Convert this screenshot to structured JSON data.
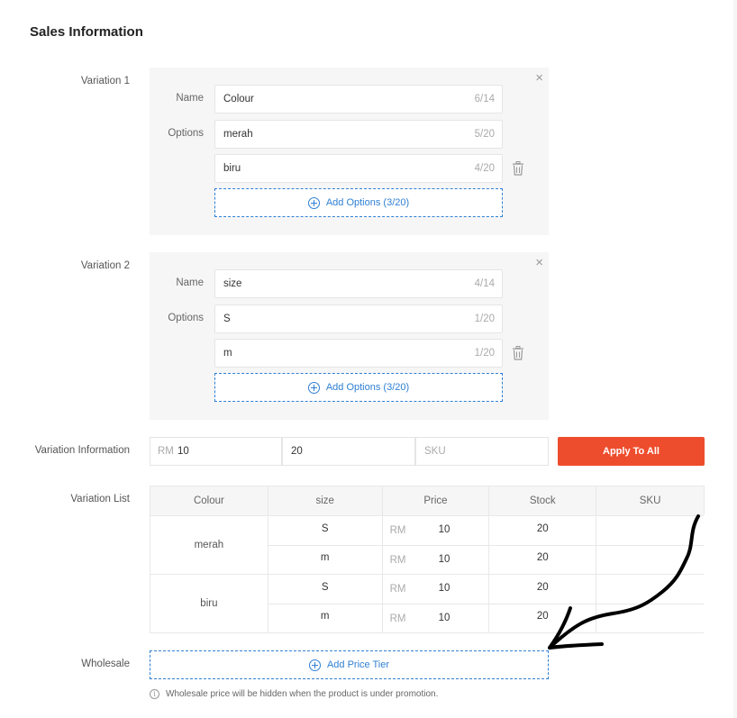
{
  "section": {
    "title": "Sales Information"
  },
  "variation1": {
    "label": "Variation 1",
    "name_label": "Name",
    "name_value": "Colour",
    "name_count": "6/14",
    "options_label": "Options",
    "options": [
      {
        "value": "merah",
        "count": "5/20"
      },
      {
        "value": "biru",
        "count": "4/20"
      }
    ],
    "add_label": "Add Options (3/20)",
    "close_glyph": "×"
  },
  "variation2": {
    "label": "Variation 2",
    "name_label": "Name",
    "name_value": "size",
    "name_count": "4/14",
    "options_label": "Options",
    "options": [
      {
        "value": "S",
        "count": "1/20"
      },
      {
        "value": "m",
        "count": "1/20"
      }
    ],
    "add_label": "Add Options (3/20)",
    "close_glyph": "×"
  },
  "variation_info": {
    "label": "Variation Information",
    "price_prefix": "RM",
    "price": "10",
    "stock": "20",
    "sku_placeholder": "SKU",
    "apply_label": "Apply To All"
  },
  "variation_list": {
    "label": "Variation List",
    "headers": [
      "Colour",
      "size",
      "Price",
      "Stock",
      "SKU"
    ],
    "currency": "RM",
    "groups": [
      {
        "colour": "merah",
        "rows": [
          {
            "size": "S",
            "price": "10",
            "stock": "20"
          },
          {
            "size": "m",
            "price": "10",
            "stock": "20"
          }
        ]
      },
      {
        "colour": "biru",
        "rows": [
          {
            "size": "S",
            "price": "10",
            "stock": "20"
          },
          {
            "size": "m",
            "price": "10",
            "stock": "20"
          }
        ]
      }
    ]
  },
  "wholesale": {
    "label": "Wholesale",
    "add_label": "Add Price Tier",
    "note": "Wholesale price will be hidden when the product is under promotion.",
    "info_glyph": "i"
  },
  "colors": {
    "accent": "#ee4d2d",
    "link": "#2f7fd3",
    "annotation": "#000000"
  },
  "icons": [
    "close-icon",
    "trash-icon",
    "plus-circle-icon",
    "info-icon",
    "hand-drawn-arrow"
  ]
}
